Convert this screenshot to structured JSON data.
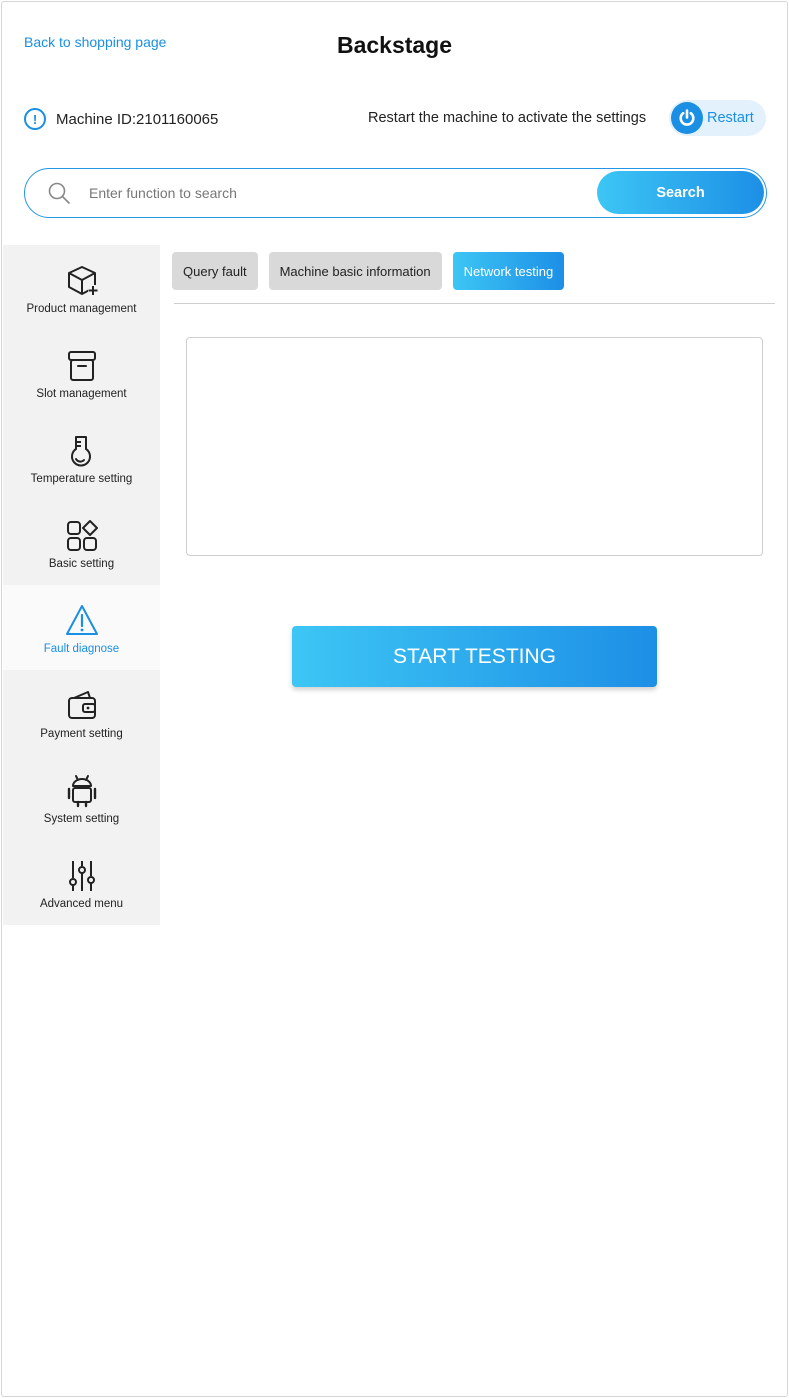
{
  "header": {
    "back_link": "Back to shopping page",
    "title": "Backstage"
  },
  "machine": {
    "id_text": "Machine ID:2101160065",
    "restart_hint": "Restart the machine to activate the settings",
    "restart_label": "Restart"
  },
  "search": {
    "placeholder": "Enter function to search",
    "value": "",
    "button_label": "Search"
  },
  "sidebar": {
    "items": [
      {
        "label": "Product management",
        "icon": "box-plus-icon",
        "active": false
      },
      {
        "label": "Slot management",
        "icon": "archive-box-icon",
        "active": false
      },
      {
        "label": "Temperature setting",
        "icon": "thermometer-flask-icon",
        "active": false
      },
      {
        "label": "Basic setting",
        "icon": "apps-grid-icon",
        "active": false
      },
      {
        "label": "Fault diagnose",
        "icon": "warning-triangle-icon",
        "active": true
      },
      {
        "label": "Payment setting",
        "icon": "wallet-icon",
        "active": false
      },
      {
        "label": "System setting",
        "icon": "android-icon",
        "active": false
      },
      {
        "label": "Advanced menu",
        "icon": "sliders-icon",
        "active": false
      }
    ]
  },
  "tabs": [
    {
      "label": "Query fault",
      "active": false
    },
    {
      "label": "Machine basic information",
      "active": false
    },
    {
      "label": "Network testing",
      "active": true
    }
  ],
  "main": {
    "result_text": "",
    "start_button": "START TESTING"
  },
  "colors": {
    "accent": "#1a8fe3",
    "gradient_start": "#3dc6f5",
    "gradient_end": "#1d8fe6",
    "sidebar_bg": "#f2f2f2",
    "tab_inactive_bg": "#d9d9d9"
  }
}
